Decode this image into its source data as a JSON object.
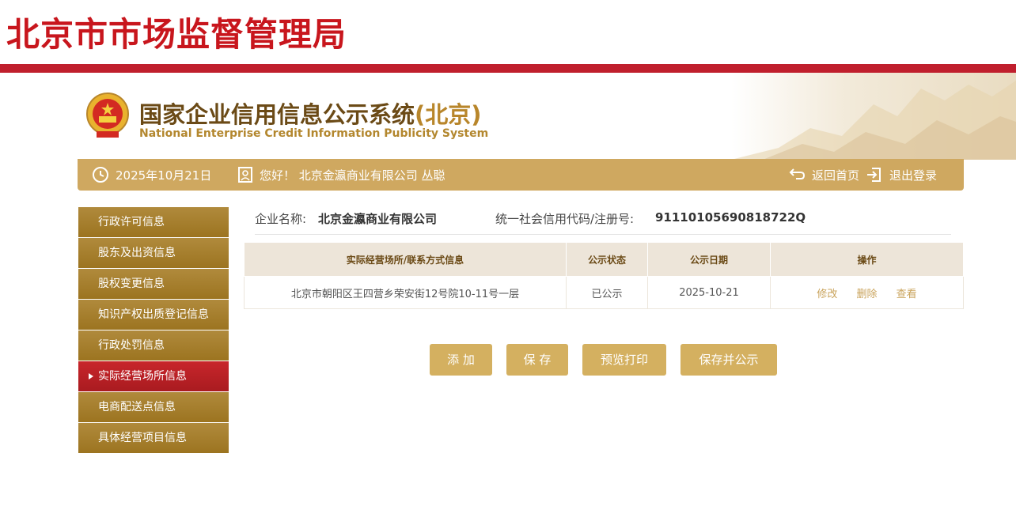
{
  "bureau_title": "北京市市场监督管理局",
  "system": {
    "title": "国家企业信用信息公示系统",
    "region": "(北京)",
    "subtitle": "National Enterprise Credit Information Publicity System"
  },
  "goldbar": {
    "date": "2025年10月21日",
    "greeting": "您好！ 北京金瀛商业有限公司 丛聪",
    "home_label": "返回首页",
    "logout_label": "退出登录"
  },
  "sidebar": {
    "items": [
      {
        "label": "行政许可信息"
      },
      {
        "label": "股东及出资信息"
      },
      {
        "label": "股权变更信息"
      },
      {
        "label": "知识产权出质登记信息"
      },
      {
        "label": "行政处罚信息"
      },
      {
        "label": "实际经营场所信息"
      },
      {
        "label": "电商配送点信息"
      },
      {
        "label": "具体经营项目信息"
      }
    ],
    "active_index": 5
  },
  "company": {
    "name_label": "企业名称:",
    "name_value": "北京金瀛商业有限公司",
    "code_label": "统一社会信用代码/注册号:",
    "code_value": "91110105690818722Q"
  },
  "table": {
    "headers": [
      "实际经营场所/联系方式信息",
      "公示状态",
      "公示日期",
      "操作"
    ],
    "rows": [
      {
        "address": "北京市朝阳区王四营乡荣安街12号院10-11号一层",
        "status": "已公示",
        "date": "2025-10-21",
        "ops": [
          "修改",
          "删除",
          "查看"
        ]
      }
    ]
  },
  "buttons": {
    "add": "添 加",
    "save": "保 存",
    "preview": "预览打印",
    "save_publish": "保存并公示"
  },
  "colors": {
    "brand_red": "#c01f2d",
    "gold": "#cfa860",
    "sidebar_brown": "#a47c2a",
    "active_red": "#b01e24"
  }
}
